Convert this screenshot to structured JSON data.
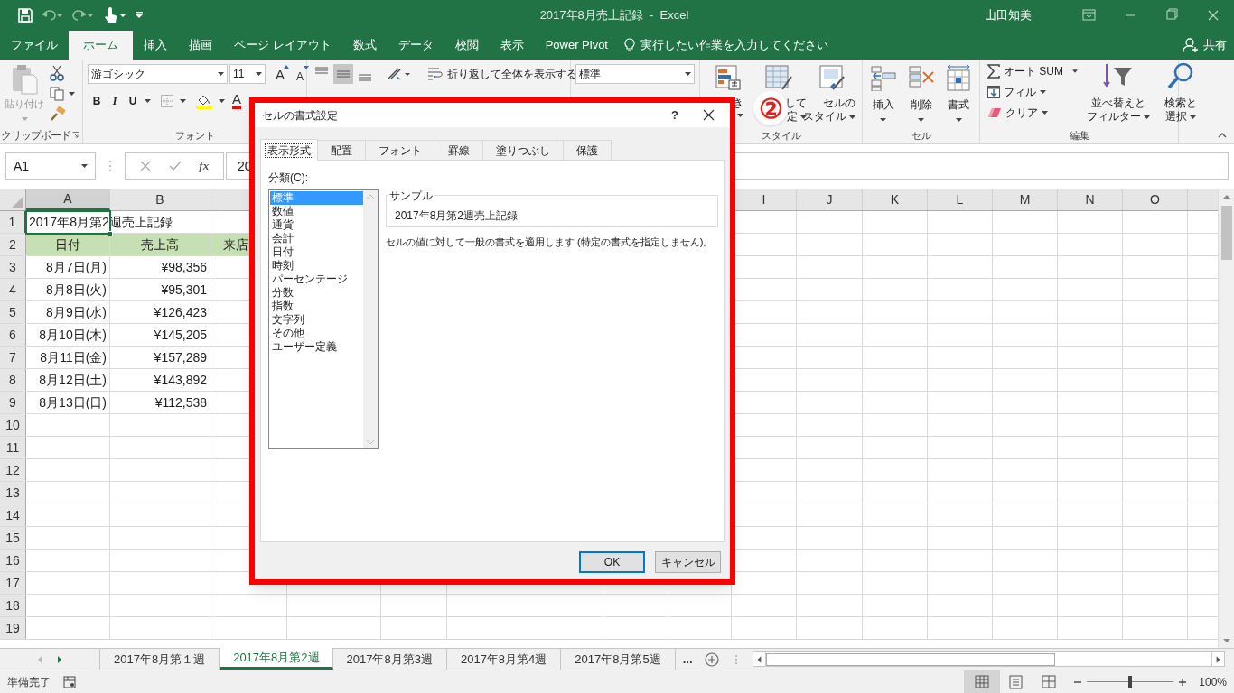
{
  "title_bar": {
    "title": "2017年8月売上記録  -  Excel",
    "user": "山田知美"
  },
  "ribbon_tabs": [
    {
      "label": "ファイル",
      "selected": false
    },
    {
      "label": "ホーム",
      "selected": true
    },
    {
      "label": "挿入",
      "selected": false
    },
    {
      "label": "描画",
      "selected": false
    },
    {
      "label": "ページ レイアウト",
      "selected": false
    },
    {
      "label": "数式",
      "selected": false
    },
    {
      "label": "データ",
      "selected": false
    },
    {
      "label": "校閲",
      "selected": false
    },
    {
      "label": "表示",
      "selected": false
    },
    {
      "label": "Power Pivot",
      "selected": false
    }
  ],
  "tell_me": "実行したい作業を入力してください",
  "share": "共有",
  "ribbon": {
    "clipboard": {
      "paste": "貼り付け",
      "label": "クリップボード"
    },
    "font": {
      "font_name": "游ゴシック",
      "font_size": "11",
      "grow": "A",
      "shrink": "A",
      "bold": "B",
      "italic": "I",
      "underline": "U",
      "font_color": "A",
      "label": "フォント"
    },
    "alignment": {
      "wrap_text": "折り返して全体を表示する"
    },
    "number": {
      "format": "標準"
    },
    "styles": {
      "buttons": [
        {
          "lines": [
            "き"
          ]
        },
        {
          "lines": [
            "して",
            "定"
          ]
        },
        {
          "lines": [
            "セルの",
            "スタイル"
          ]
        }
      ],
      "label": "スタイル"
    },
    "cells": {
      "buttons": [
        "挿入",
        "削除",
        "書式"
      ],
      "label": "セル"
    },
    "editing": {
      "autosum": "オート SUM",
      "fill": "フィル",
      "clear": "クリア",
      "sort": [
        "並べ替えと",
        "フィルター"
      ],
      "find": [
        "検索と",
        "選択"
      ],
      "label": "編集"
    }
  },
  "formula_bar": {
    "name_box": "A1",
    "fx": "fx",
    "content": "20"
  },
  "sheet": {
    "columns_left": [
      "A",
      "B"
    ],
    "columns_right": [
      "I",
      "J",
      "K",
      "L",
      "M",
      "N",
      "O"
    ],
    "rows": [
      {
        "number": "1",
        "kind": "title",
        "selected": true,
        "cells": [
          "2017年8月第2週売上記録"
        ]
      },
      {
        "number": "2",
        "kind": "header",
        "selected": false,
        "cells": [
          "日付",
          "売上高",
          "来店"
        ]
      },
      {
        "number": "3",
        "kind": "data",
        "selected": false,
        "cells": [
          "8月7日(月)",
          "¥98,356"
        ]
      },
      {
        "number": "4",
        "kind": "data",
        "selected": false,
        "cells": [
          "8月8日(火)",
          "¥95,301"
        ]
      },
      {
        "number": "5",
        "kind": "data",
        "selected": false,
        "cells": [
          "8月9日(水)",
          "¥126,423"
        ]
      },
      {
        "number": "6",
        "kind": "data",
        "selected": false,
        "cells": [
          "8月10日(木)",
          "¥145,205"
        ]
      },
      {
        "number": "7",
        "kind": "data",
        "selected": false,
        "cells": [
          "8月11日(金)",
          "¥157,289"
        ]
      },
      {
        "number": "8",
        "kind": "data",
        "selected": false,
        "cells": [
          "8月12日(土)",
          "¥143,892"
        ]
      },
      {
        "number": "9",
        "kind": "data",
        "selected": false,
        "cells": [
          "8月13日(日)",
          "¥112,538"
        ]
      },
      {
        "number": "10",
        "kind": "data",
        "selected": false
      },
      {
        "number": "11",
        "kind": "data",
        "selected": false
      },
      {
        "number": "12",
        "kind": "data",
        "selected": false
      },
      {
        "number": "13",
        "kind": "data",
        "selected": false
      },
      {
        "number": "14",
        "kind": "data",
        "selected": false
      },
      {
        "number": "15",
        "kind": "data",
        "selected": false
      },
      {
        "number": "16",
        "kind": "data",
        "selected": false
      },
      {
        "number": "17",
        "kind": "data",
        "selected": false
      },
      {
        "number": "18",
        "kind": "data",
        "selected": false
      },
      {
        "number": "19",
        "kind": "data",
        "selected": false
      }
    ]
  },
  "sheet_tabs": [
    {
      "label": "2017年8月第１週",
      "selected": false
    },
    {
      "label": "2017年8月第2週",
      "selected": true
    },
    {
      "label": "2017年8月第3週",
      "selected": false
    },
    {
      "label": "2017年8月第4週",
      "selected": false
    },
    {
      "label": "2017年8月第5週",
      "selected": false
    }
  ],
  "more_tabs": "...",
  "status_bar": {
    "status": "準備完了",
    "zoom": "100%",
    "zoom_level": {
      "level": 0.5
    }
  },
  "dialog": {
    "title": "セルの書式設定",
    "help": "?",
    "tabs": [
      {
        "label": "表示形式",
        "selected": true
      },
      {
        "label": "配置",
        "selected": false
      },
      {
        "label": "フォント",
        "selected": false
      },
      {
        "label": "罫線",
        "selected": false
      },
      {
        "label": "塗りつぶし",
        "selected": false
      },
      {
        "label": "保護",
        "selected": false
      }
    ],
    "category_label": "分類(C):",
    "categories": [
      {
        "label": "標準",
        "selected": true
      },
      {
        "label": "数値",
        "selected": false
      },
      {
        "label": "通貨",
        "selected": false
      },
      {
        "label": "会計",
        "selected": false
      },
      {
        "label": "日付",
        "selected": false
      },
      {
        "label": "時刻",
        "selected": false
      },
      {
        "label": "パーセンテージ",
        "selected": false
      },
      {
        "label": "分数",
        "selected": false
      },
      {
        "label": "指数",
        "selected": false
      },
      {
        "label": "文字列",
        "selected": false
      },
      {
        "label": "その他",
        "selected": false
      },
      {
        "label": "ユーザー定義",
        "selected": false
      }
    ],
    "sample_label": "サンプル",
    "sample_value": "2017年8月第2週売上記録",
    "description": "セルの値に対して一般の書式を適用します (特定の書式を指定しません)。",
    "buttons": [
      {
        "label": "OK",
        "default": true
      },
      {
        "label": "キャンセル",
        "default": false
      }
    ]
  },
  "annotation": {
    "label": "②"
  }
}
